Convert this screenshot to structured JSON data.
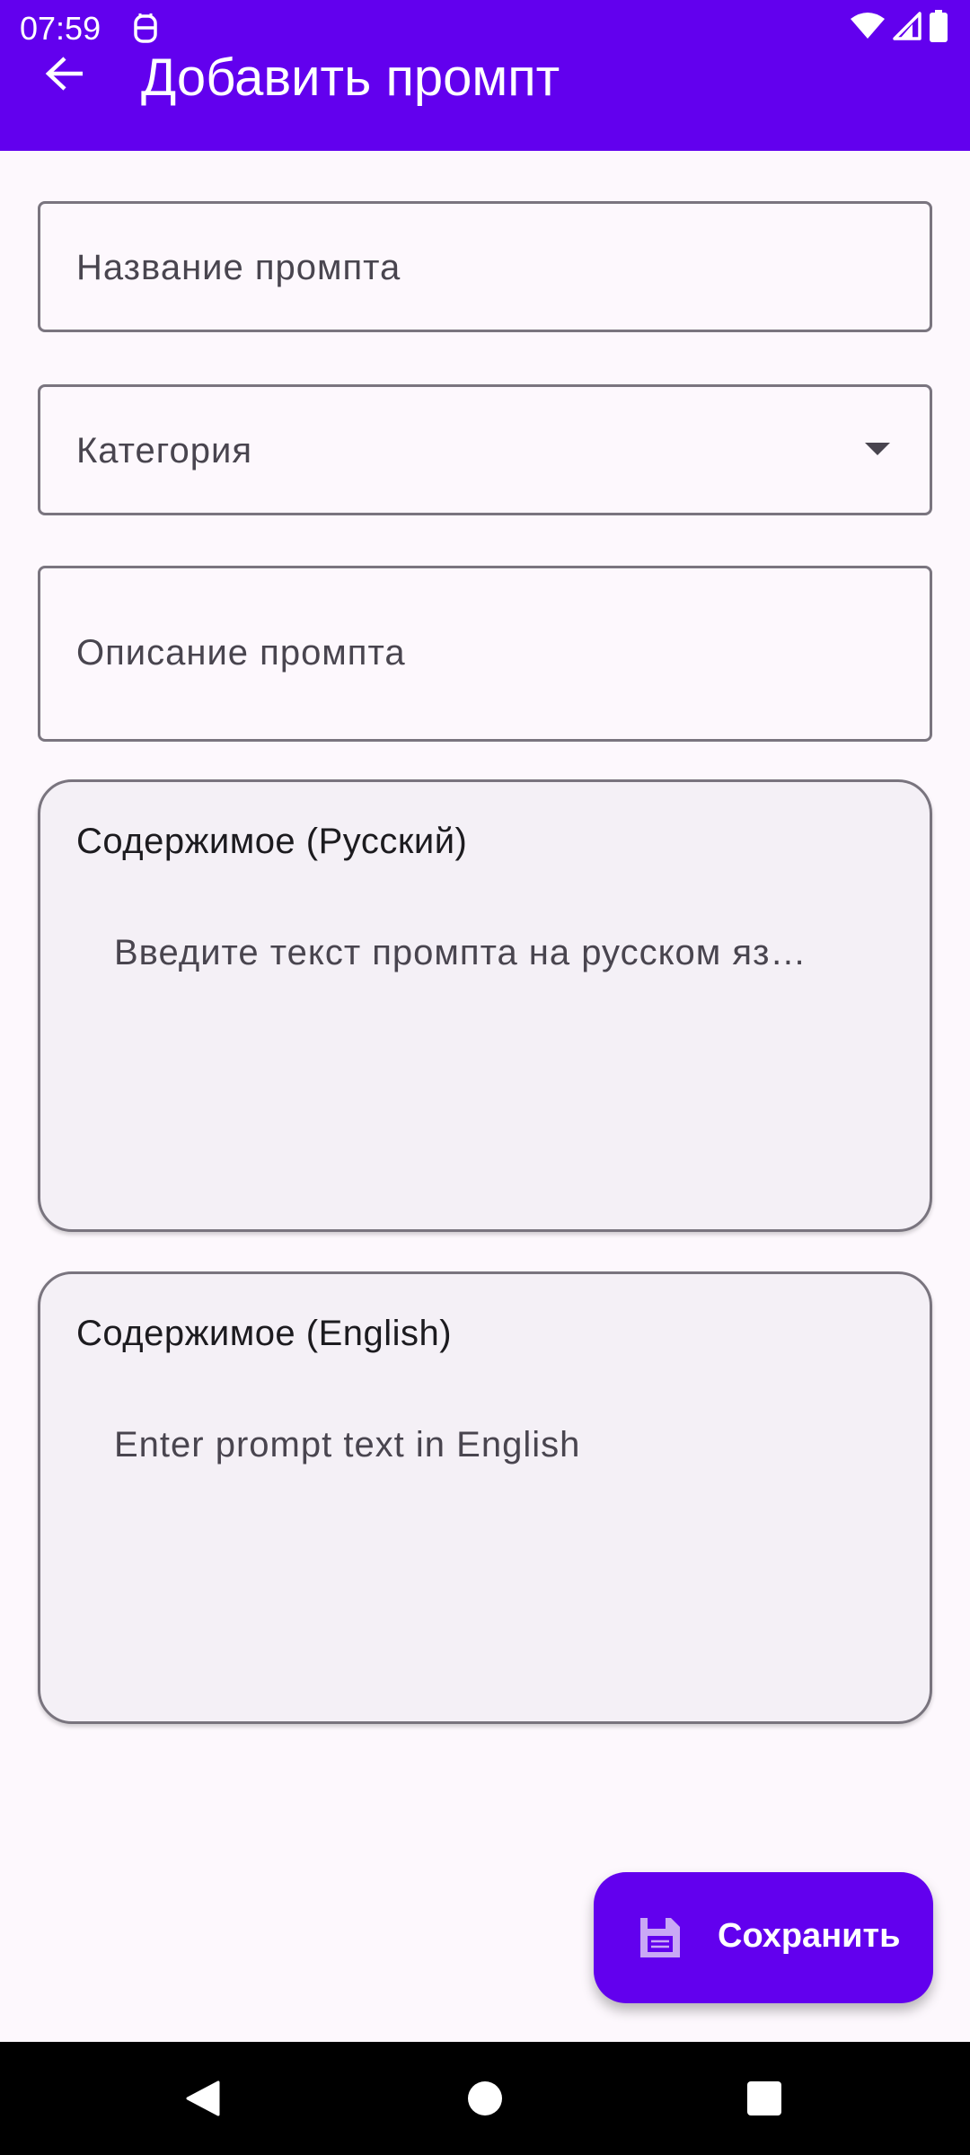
{
  "status_bar": {
    "time": "07:59",
    "icons": [
      "notification-app-icon",
      "wifi-icon",
      "signal-icon",
      "battery-icon"
    ]
  },
  "app_bar": {
    "title": "Добавить промпт",
    "back_icon": "arrow-back-icon",
    "background_color": "#6200ee"
  },
  "form": {
    "name_field": {
      "placeholder": "Название промпта",
      "value": ""
    },
    "category_field": {
      "placeholder": "Категория",
      "value": "",
      "icon": "dropdown-arrow-icon"
    },
    "description_field": {
      "placeholder": "Описание промпта",
      "value": ""
    },
    "content_ru": {
      "title": "Содержимое (Русский)",
      "placeholder": "Введите текст промпта на русском яз…",
      "value": ""
    },
    "content_en": {
      "title": "Содержимое (English)",
      "placeholder": "Enter prompt text in English",
      "value": ""
    }
  },
  "fab": {
    "label": "Сохранить",
    "icon": "save-icon",
    "color": "#6200ee"
  },
  "nav_bar": {
    "buttons": [
      "back-icon",
      "home-icon",
      "recents-icon"
    ]
  }
}
